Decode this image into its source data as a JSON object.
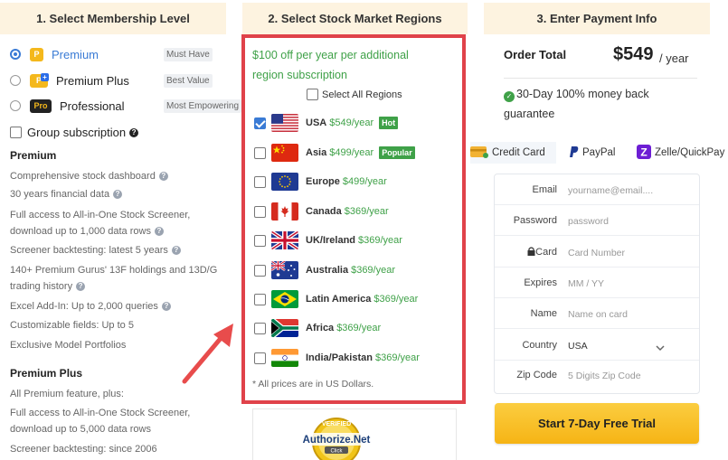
{
  "columns": {
    "membership_title": "1. Select Membership Level",
    "regions_title": "2. Select Stock Market Regions",
    "payment_title": "3. Enter Payment Info"
  },
  "membership": {
    "plans": [
      {
        "badge": "P",
        "name": "Premium",
        "tag": "Must Have",
        "selected": true
      },
      {
        "badge": "P",
        "name": "Premium Plus",
        "tag": "Best Value",
        "selected": false
      },
      {
        "badge": "Pro",
        "name": "Professional",
        "tag": "Most Empowering",
        "selected": false
      }
    ],
    "group_label": "Group subscription",
    "premium_title": "Premium",
    "premium_features": [
      "Comprehensive stock dashboard",
      "30 years financial data",
      "Full access to All-in-One Stock Screener, download up to 1,000 data rows",
      "Screener backtesting: latest 5 years",
      "140+ Premium Gurus' 13F holdings and 13D/G trading history",
      "Excel Add-In: Up to 2,000 queries",
      "Customizable fields: Up to 5",
      "Exclusive Model Portfolios"
    ],
    "plus_title": "Premium Plus",
    "plus_features": [
      "All Premium feature, plus:",
      "Full access to All-in-One Stock Screener, download up to 5,000 data rows",
      "Screener backtesting: since 2006"
    ]
  },
  "regions": {
    "promo": "$100 off per year per additional region subscription",
    "select_all": "Select All Regions",
    "items": [
      {
        "name": "USA",
        "price": "$549/year",
        "badge": "Hot",
        "checked": true,
        "flag": "usa-flag-icon"
      },
      {
        "name": "Asia",
        "price": "$499/year",
        "badge": "Popular",
        "checked": false,
        "flag": "china-flag-icon"
      },
      {
        "name": "Europe",
        "price": "$499/year",
        "badge": "",
        "checked": false,
        "flag": "eu-flag-icon"
      },
      {
        "name": "Canada",
        "price": "$369/year",
        "badge": "",
        "checked": false,
        "flag": "canada-flag-icon"
      },
      {
        "name": "UK/Ireland",
        "price": "$369/year",
        "badge": "",
        "checked": false,
        "flag": "uk-flag-icon"
      },
      {
        "name": "Australia",
        "price": "$369/year",
        "badge": "",
        "checked": false,
        "flag": "australia-flag-icon"
      },
      {
        "name": "Latin America",
        "price": "$369/year",
        "badge": "",
        "checked": false,
        "flag": "brazil-flag-icon"
      },
      {
        "name": "Africa",
        "price": "$369/year",
        "badge": "",
        "checked": false,
        "flag": "south-africa-flag-icon"
      },
      {
        "name": "India/Pakistan",
        "price": "$369/year",
        "badge": "",
        "checked": false,
        "flag": "india-flag-icon"
      }
    ],
    "footnote": "* All prices are in US Dollars.",
    "seal": {
      "top": "VERIFIED",
      "brand": "Authorize.Net",
      "click": "Click"
    }
  },
  "payment": {
    "order_label": "Order Total",
    "order_price": "$549",
    "order_period": "/ year",
    "guarantee": "30-Day 100% money back guarantee",
    "tabs": [
      "Credit Card",
      "PayPal",
      "Zelle/QuickPay"
    ],
    "fields": {
      "email": {
        "label": "Email",
        "placeholder": "yourname@email...."
      },
      "password": {
        "label": "Password",
        "placeholder": "password"
      },
      "card": {
        "label": "Card",
        "placeholder": "Card Number"
      },
      "expires": {
        "label": "Expires",
        "placeholder": "MM / YY"
      },
      "name": {
        "label": "Name",
        "placeholder": "Name on card"
      },
      "country": {
        "label": "Country",
        "value": "USA"
      },
      "zip": {
        "label": "Zip Code",
        "placeholder": "5 Digits Zip Code"
      }
    },
    "submit": "Start 7-Day Free Trial"
  },
  "colors": {
    "accent_green": "#3fa148",
    "highlight_red": "#e0424a",
    "button_yellow": "#f6b415",
    "header_bg": "#fdf3e0",
    "select_blue": "#3a7bd5"
  }
}
